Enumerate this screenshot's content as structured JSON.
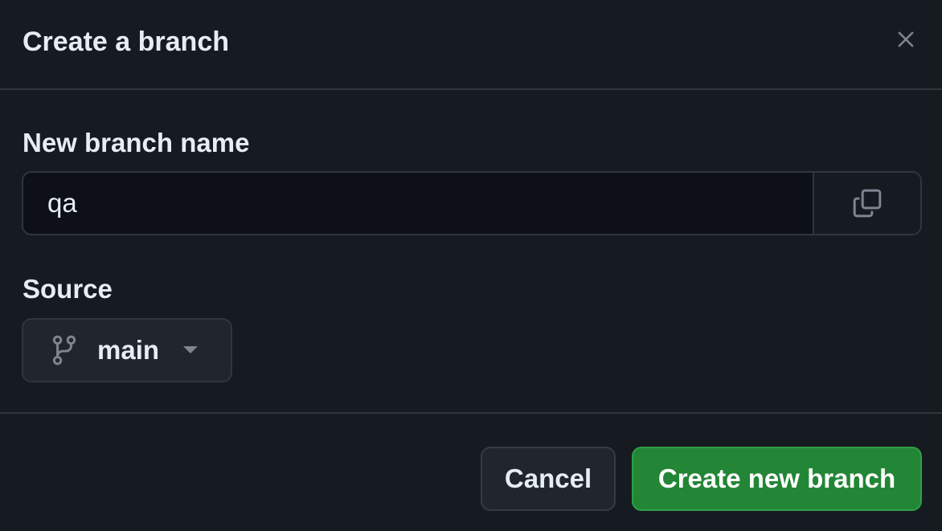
{
  "dialog": {
    "title": "Create a branch",
    "close_icon": "x-icon"
  },
  "form": {
    "branch_name_label": "New branch name",
    "branch_name_value": "qa",
    "copy_icon": "copy-icon",
    "source_label": "Source",
    "source_branch": "main",
    "source_icon": "git-branch-icon",
    "caret_icon": "triangle-down-icon"
  },
  "footer": {
    "cancel_label": "Cancel",
    "create_label": "Create new branch"
  },
  "colors": {
    "background": "#161b22",
    "border": "#30363d",
    "primary_button": "#238636",
    "text": "#e6edf3",
    "muted_icon": "#7d8590"
  }
}
